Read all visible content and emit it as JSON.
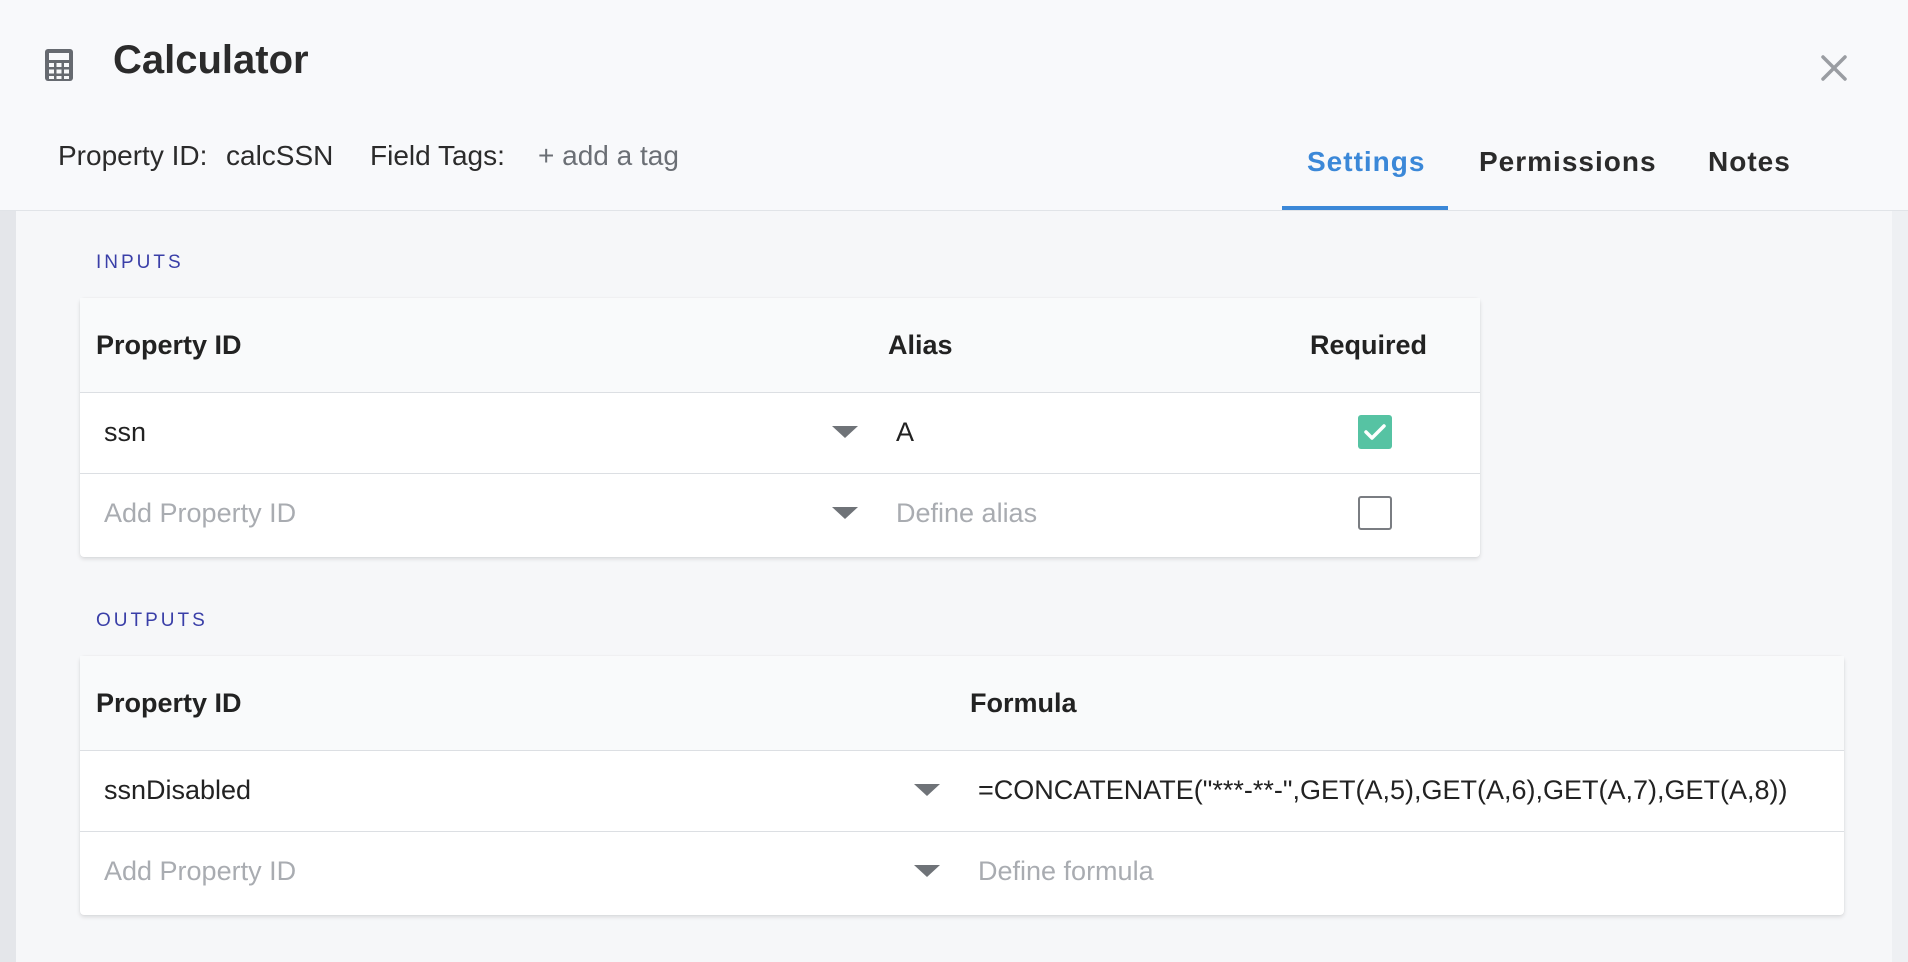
{
  "header": {
    "title": "Calculator",
    "property_id_label": "Property ID:",
    "property_id_value": "calcSSN",
    "field_tags_label": "Field Tags:",
    "add_tag_label": "+ add a tag",
    "tabs": [
      {
        "label": "Settings",
        "active": true
      },
      {
        "label": "Permissions",
        "active": false
      },
      {
        "label": "Notes",
        "active": false
      }
    ]
  },
  "inputs": {
    "section_label": "INPUTS",
    "columns": [
      "Property ID",
      "Alias",
      "Required"
    ],
    "rows": [
      {
        "property_id": "ssn",
        "alias": "A",
        "required": true
      },
      {
        "property_id_placeholder": "Add Property ID",
        "alias_placeholder": "Define alias",
        "required": false
      }
    ]
  },
  "outputs": {
    "section_label": "OUTPUTS",
    "columns": [
      "Property ID",
      "Formula"
    ],
    "rows": [
      {
        "property_id": "ssnDisabled",
        "formula": "=CONCATENATE(\"***-**-\",GET(A,5),GET(A,6),GET(A,7),GET(A,8))"
      },
      {
        "property_id_placeholder": "Add Property ID",
        "formula_placeholder": "Define formula"
      }
    ]
  },
  "colors": {
    "accent": "#3b88d8",
    "section_label": "#3a3fa8",
    "checkbox_checked": "#56c3a3"
  }
}
